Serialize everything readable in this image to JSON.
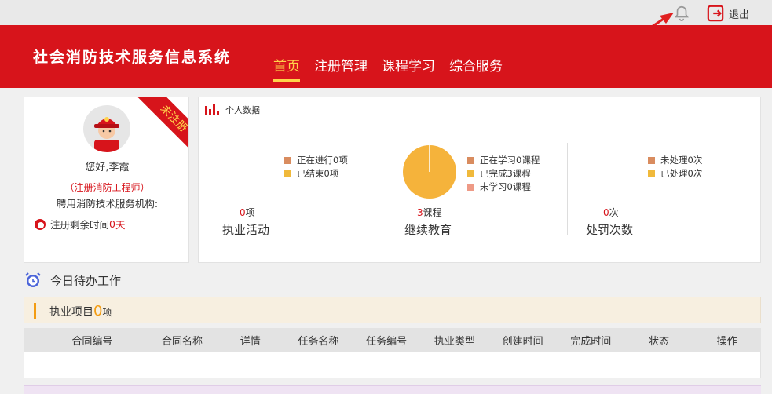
{
  "topbar": {
    "logout_label": "退出"
  },
  "header": {
    "title": "社会消防技术服务信息系统",
    "nav": [
      {
        "label": "首页",
        "active": true
      },
      {
        "label": "注册管理"
      },
      {
        "label": "课程学习"
      },
      {
        "label": "综合服务"
      }
    ]
  },
  "profile": {
    "ribbon": "未注册",
    "greeting": "您好,李霞",
    "role": "（注册消防工程师）",
    "org": "聘用消防技术服务机构:",
    "remain_prefix": "注册剩余时间",
    "remain_value": "0",
    "remain_unit": "天"
  },
  "stats": {
    "title": "个人数据",
    "practice": {
      "legend": [
        "正在进行0项",
        "已结束0项"
      ],
      "count": "0",
      "unit": "项",
      "label": "执业活动"
    },
    "education": {
      "legend": [
        "正在学习0课程",
        "已完成3课程",
        "未学习0课程"
      ],
      "count": "3",
      "unit": "课程",
      "label": "继续教育"
    },
    "penalty": {
      "legend": [
        "未处理0次",
        "已处理0次"
      ],
      "count": "0",
      "unit": "次",
      "label": "处罚次数"
    },
    "colors": {
      "ongoing": "#d98c5f",
      "done": "#f0b93b",
      "notstarted": "#ee9a86",
      "pie": "#f5b33b"
    }
  },
  "todo": {
    "title": "今日待办工作",
    "project_label": "执业项目",
    "project_count": "0",
    "project_unit": "项",
    "columns": [
      "合同编号",
      "合同名称",
      "详情",
      "任务名称",
      "任务编号",
      "执业类型",
      "创建时间",
      "完成时间",
      "状态",
      "操作"
    ]
  }
}
